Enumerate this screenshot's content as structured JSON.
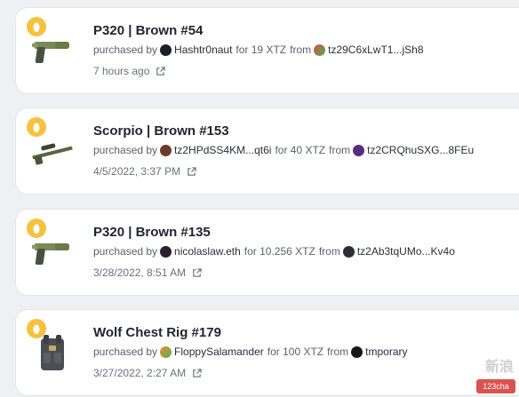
{
  "activity": [
    {
      "title": "P320 | Brown #54",
      "purchased_by_label": "purchased by",
      "buyer": "Hashtr0naut",
      "price": "for 19 XTZ",
      "from_label": "from",
      "seller": "tz29C6xLwT1...jSh8",
      "time": "7 hours ago",
      "item_icon": "pistol-icon"
    },
    {
      "title": "Scorpio | Brown #153",
      "purchased_by_label": "purchased by",
      "buyer": "tz2HPdSS4KM...qt6i",
      "price": "for 40 XTZ",
      "from_label": "from",
      "seller": "tz2CRQhuSXG...8FEu",
      "time": "4/5/2022, 3:37 PM",
      "item_icon": "sniper-rifle-icon"
    },
    {
      "title": "P320 | Brown #135",
      "purchased_by_label": "purchased by",
      "buyer": "nicolaslaw.eth",
      "price": "for 10.256 XTZ",
      "from_label": "from",
      "seller": "tz2Ab3tqUMo...Kv4o",
      "time": "3/28/2022, 8:51 AM",
      "item_icon": "pistol-icon"
    },
    {
      "title": "Wolf Chest Rig #179",
      "purchased_by_label": "purchased by",
      "buyer": "FloppySalamander",
      "price": "for 100 XTZ",
      "from_label": "from",
      "seller": "tmporary",
      "time": "3/27/2022, 2:27 AM",
      "item_icon": "chest-rig-icon"
    }
  ],
  "watermark": "新浪",
  "watermark_logo": "123cha"
}
